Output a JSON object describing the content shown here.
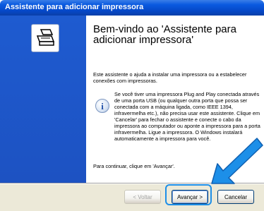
{
  "window": {
    "title": "Assistente para adicionar impressora"
  },
  "header": {
    "heading": "Bem-vindo ao 'Assistente para\nadicionar impressora'"
  },
  "body": {
    "intro": "Este assistente o ajuda a instalar uma impressora ou a estabelecer conexões com impressoras.",
    "info": "Se você tiver uma impressora Plug and Play conectada através de uma porta USB (ou qualquer outra porta que possa ser conectada com a máquina ligada, como IEEE 1394, infravermelha etc.), não precisa usar este assistente. Clique em 'Cancelar' para fechar o assistente e conecte o cabo da impressora ao computador ou aponte a impressora para a porta infravermelha. Ligue a impressora. O Windows instalará automaticamente a impressora para você.",
    "continue": "Para continuar, clique em 'Avançar'."
  },
  "footer": {
    "back_label": "< Voltar",
    "next_label": "Avançar >",
    "cancel_label": "Cancelar"
  },
  "icons": {
    "printer": "printer-icon",
    "info": "info-icon",
    "arrow": "pointer-arrow"
  },
  "colors": {
    "titlebar": "#0a5ae0",
    "left_panel": "#1d55c8",
    "footer": "#ece9d8",
    "highlight": "#1d8fe8"
  }
}
